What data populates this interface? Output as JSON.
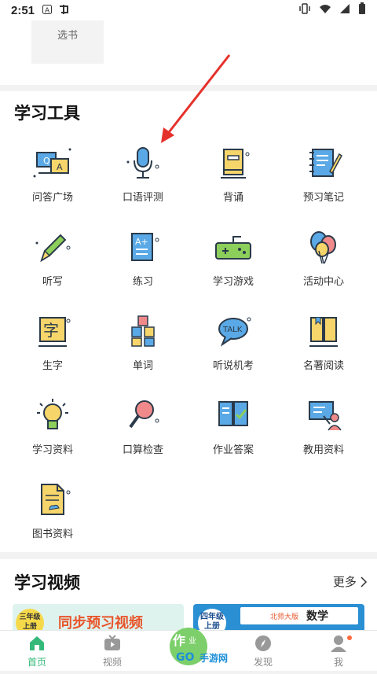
{
  "status_bar": {
    "time": "2:51"
  },
  "top": {
    "select_book_label": "选书"
  },
  "tools": {
    "title": "学习工具",
    "items": [
      {
        "label": "问答广场",
        "icon": "qa-square-icon"
      },
      {
        "label": "口语评测",
        "icon": "microphone-icon"
      },
      {
        "label": "背诵",
        "icon": "book-recite-icon"
      },
      {
        "label": "预习笔记",
        "icon": "notebook-icon"
      },
      {
        "label": "听写",
        "icon": "pen-icon"
      },
      {
        "label": "练习",
        "icon": "exercise-sheet-icon"
      },
      {
        "label": "学习游戏",
        "icon": "gamepad-icon"
      },
      {
        "label": "活动中心",
        "icon": "balloons-icon"
      },
      {
        "label": "生字",
        "icon": "character-board-icon"
      },
      {
        "label": "单词",
        "icon": "letter-blocks-icon"
      },
      {
        "label": "听说机考",
        "icon": "talk-bubble-icon"
      },
      {
        "label": "名著阅读",
        "icon": "open-book-icon"
      },
      {
        "label": "学习资料",
        "icon": "lightbulb-icon"
      },
      {
        "label": "口算检查",
        "icon": "magnifier-icon"
      },
      {
        "label": "作业答案",
        "icon": "answer-book-icon"
      },
      {
        "label": "教用资料",
        "icon": "teacher-board-icon"
      },
      {
        "label": "图书资料",
        "icon": "document-icon"
      }
    ]
  },
  "video": {
    "title": "学习视频",
    "more_label": "更多",
    "card_a": {
      "badge": "三年级上册",
      "badge_line1": "三年级",
      "badge_line2": "上册",
      "text": "同步预习视频"
    },
    "card_b": {
      "badge_line1": "四年级",
      "badge_line2": "上册",
      "edition": "北师大版",
      "subject": "数学"
    }
  },
  "bottom_nav": {
    "items": [
      {
        "label": "首页",
        "icon": "home-icon",
        "active": true
      },
      {
        "label": "视频",
        "icon": "tv-icon",
        "active": false
      },
      {
        "label": "发现",
        "icon": "compass-icon",
        "active": false
      },
      {
        "label": "我",
        "icon": "user-icon",
        "active": false
      }
    ],
    "watermark": "手游网",
    "watermark_word": "GO"
  },
  "colors": {
    "accent": "#35b97a",
    "arrow": "#e5312b",
    "icon_dark": "#2b3a4a",
    "icon_blue": "#5aa9e6",
    "icon_yellow": "#f6d56a"
  }
}
